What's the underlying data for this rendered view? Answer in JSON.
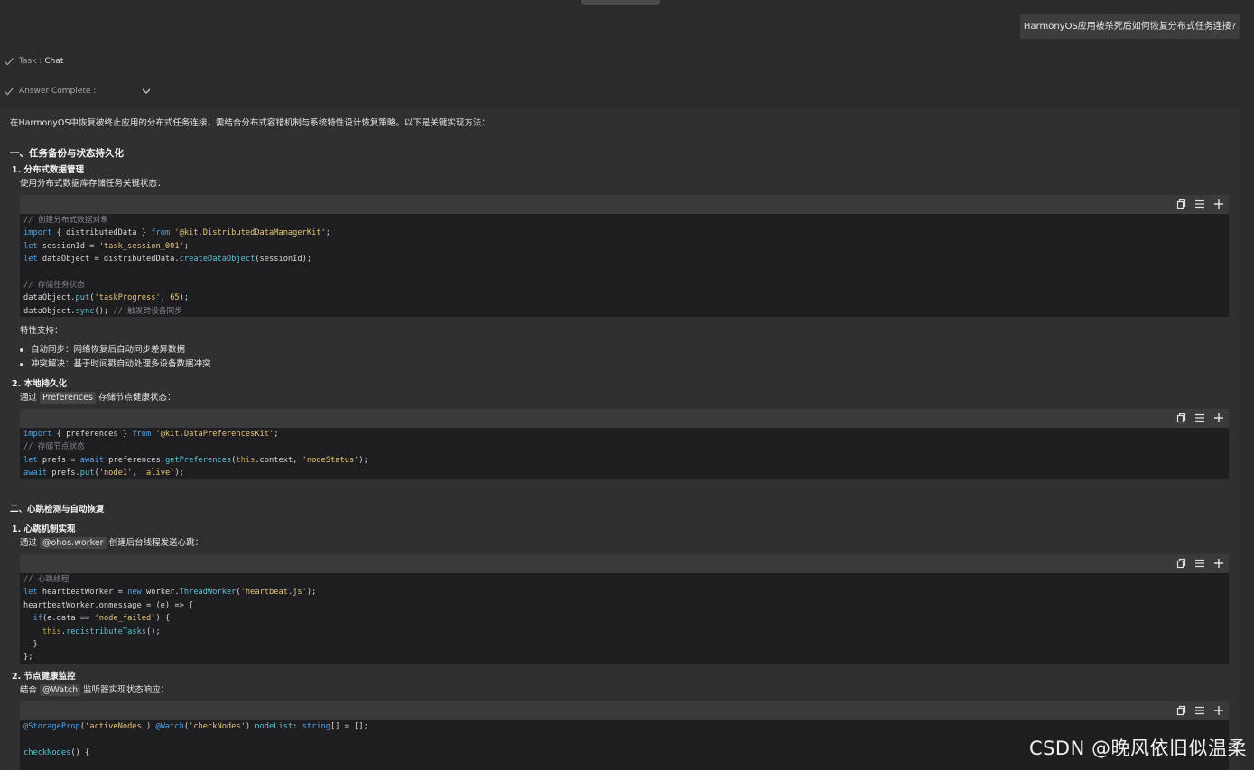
{
  "user_message": "HarmonyOS应用被杀死后如何恢复分布式任务连接?",
  "status": {
    "task_label": "Task :",
    "task_value": "Chat",
    "answer_label": "Answer Complete :"
  },
  "answer": {
    "intro": "在HarmonyOS中恢复被终止应用的分布式任务连接，需结合分布式容错机制与系统特性设计恢复策略。以下是关键实现方法：",
    "section1_title": "一、任务备份与状态持久化",
    "s1_item1_title": "1. 分布式数据管理",
    "s1_item1_desc": "使用分布式数据库存储任务关键状态：",
    "features_label": "特性支持：",
    "bullet1": "自动同步：网络恢复后自动同步差异数据",
    "bullet2": "冲突解决：基于时间戳自动处理多设备数据冲突",
    "s1_item2_title": "2. 本地持久化",
    "s1_item2_pre": "通过",
    "s1_item2_code": "Preferences",
    "s1_item2_post": "存储节点健康状态：",
    "section2_title": "二、心跳检测与自动恢复",
    "s2_item1_title": "1. 心跳机制实现",
    "s2_item1_pre": "通过",
    "s2_item1_code": "@ohos.worker",
    "s2_item1_post": "创建后台线程发送心跳：",
    "s2_item2_title": "2. 节点健康监控",
    "s2_item2_pre": "结合",
    "s2_item2_code": "@Watch",
    "s2_item2_post": "监听器实现状态响应："
  },
  "code_tools": [
    "copy-icon",
    "list-icon",
    "plus-icon"
  ],
  "watermark": "CSDN @晚风依旧似温柔",
  "colors": {
    "background": "#2b2b2d",
    "answer_panel": "#303033",
    "code_bg": "#1e1e20",
    "keyword": "#4fa3e8",
    "string": "#e8c47a",
    "comment": "#7f848e"
  }
}
